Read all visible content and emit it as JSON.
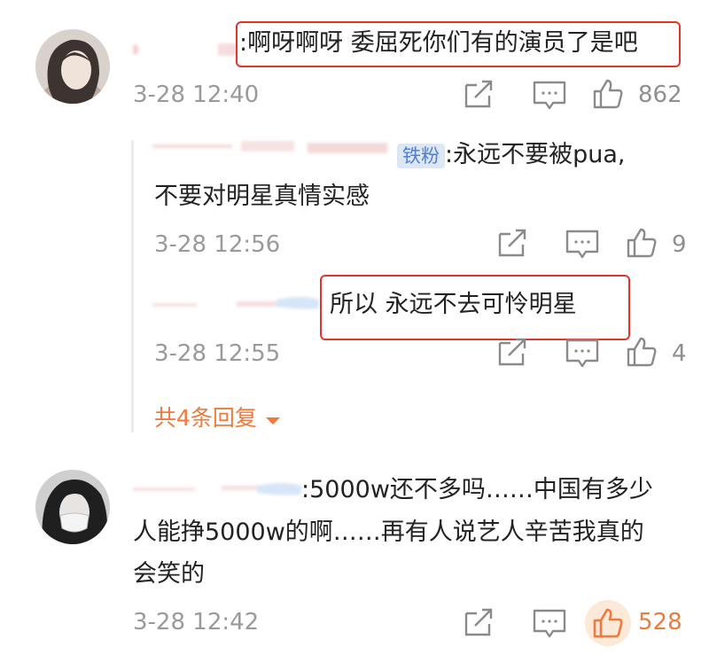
{
  "comments": [
    {
      "text": "啊呀啊呀 委屈死你们有的演员了是吧",
      "prefix": ":",
      "time": "3-28 12:40",
      "likes": "862"
    },
    {
      "text": "5000w还不多吗……中国有多少",
      "text2": "人能挣5000w的啊……再有人说艺人辛苦我真的",
      "text3": "会笑的",
      "prefix": ":",
      "time": "3-28 12:42",
      "likes": "528",
      "liked_color": "#f07a3b"
    }
  ],
  "replies": [
    {
      "badge": "铁粉",
      "text": ":永远不要被pua,",
      "text2": "不要对明星真情实感",
      "time": "3-28 12:56",
      "likes": "9"
    },
    {
      "text": "所以 永远不去可怜明星",
      "time": "3-28 12:55",
      "likes": "4"
    }
  ],
  "more_replies": "共4条回复",
  "colors": {
    "highlight_box": "#e0352b",
    "accent": "#f07a3b"
  }
}
